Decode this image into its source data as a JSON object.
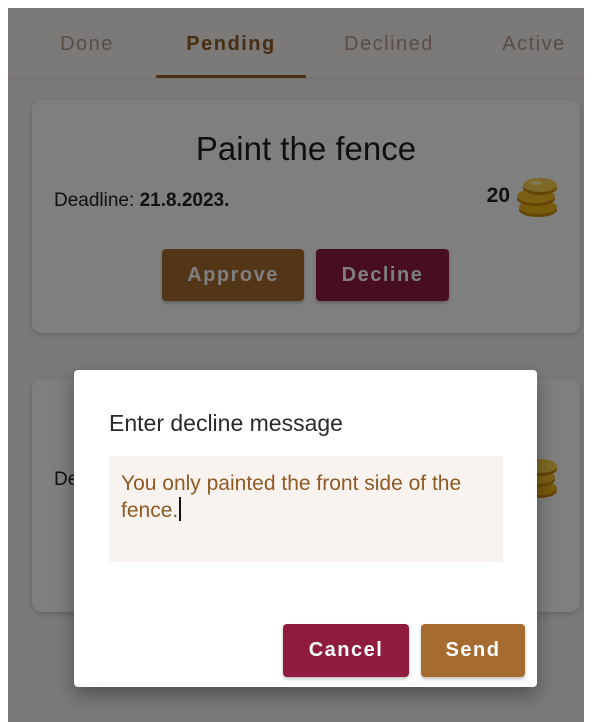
{
  "tabs": {
    "items": [
      "Done",
      "Pending",
      "Declined",
      "Active"
    ],
    "active": "Pending"
  },
  "card1": {
    "title": "Paint the fence",
    "deadline_label": "Deadline:",
    "deadline_value": "21.8.2023.",
    "reward": "20",
    "approve_label": "Approve",
    "decline_label": "Decline"
  },
  "card2": {
    "deadline_fragment": "De"
  },
  "dialog": {
    "title": "Enter decline message",
    "message_value": "You only painted the front side of the fence.",
    "cancel_label": "Cancel",
    "send_label": "Send"
  },
  "colors": {
    "brown_accent": "#a66b2e",
    "maroon_accent": "#8f1c3e",
    "coin": "#f0b419"
  },
  "icons": {
    "reward": "coin-stack-icon"
  }
}
